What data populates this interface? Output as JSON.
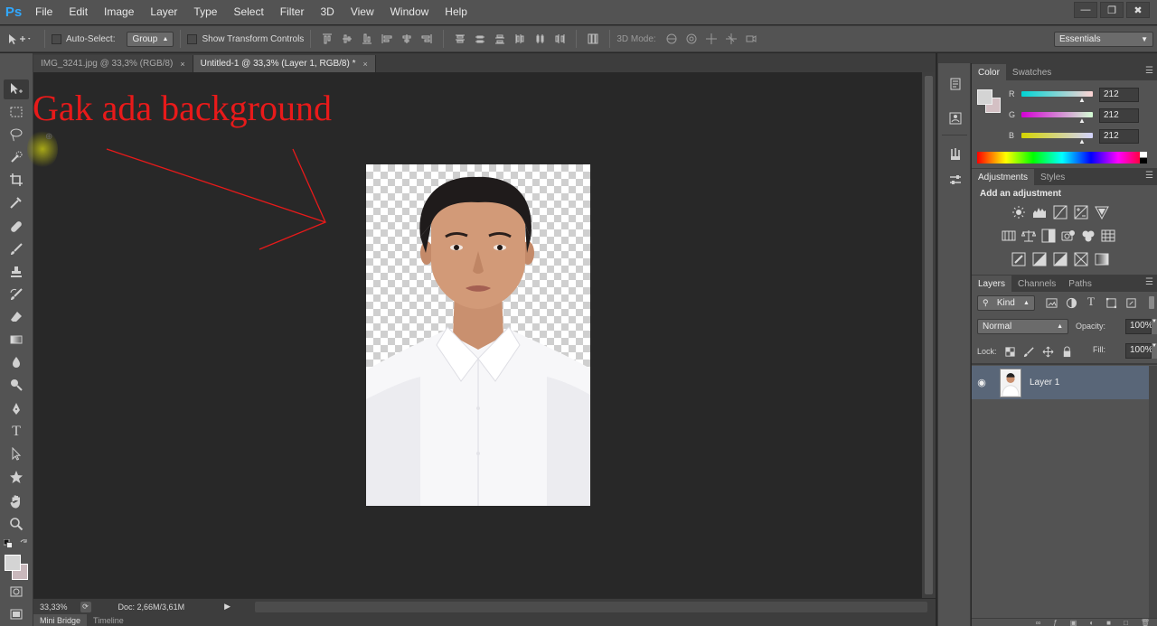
{
  "app": {
    "logo": "Ps"
  },
  "menu": [
    "File",
    "Edit",
    "Image",
    "Layer",
    "Type",
    "Select",
    "Filter",
    "3D",
    "View",
    "Window",
    "Help"
  ],
  "window_controls": {
    "minimize": "—",
    "restore": "❐",
    "close": "✖"
  },
  "options_bar": {
    "auto_select_label": "Auto-Select:",
    "auto_select_value": "Group",
    "show_transform_label": "Show Transform Controls",
    "mode_3d_label": "3D Mode:",
    "workspace": "Essentials"
  },
  "doc_tabs": [
    {
      "label": "IMG_3241.jpg @ 33,3% (RGB/8)",
      "close": "×"
    },
    {
      "label": "Untitled-1 @ 33,3% (Layer 1, RGB/8) *",
      "close": "×"
    }
  ],
  "annotation": {
    "text": "Gak ada background",
    "color": "#e81a1a"
  },
  "status": {
    "zoom": "33,33%",
    "doc": "Doc: 2,66M/3,61M"
  },
  "bottom_tabs": [
    "Mini Bridge",
    "Timeline"
  ],
  "color_panel": {
    "tabs": [
      "Color",
      "Swatches"
    ],
    "channels": [
      {
        "label": "R",
        "value": "212"
      },
      {
        "label": "G",
        "value": "212"
      },
      {
        "label": "B",
        "value": "212"
      }
    ]
  },
  "adjustments_panel": {
    "tabs": [
      "Adjustments",
      "Styles"
    ],
    "heading": "Add an adjustment"
  },
  "layers_panel": {
    "tabs": [
      "Layers",
      "Channels",
      "Paths"
    ],
    "filter_kind": "Kind",
    "blend_mode": "Normal",
    "opacity_label": "Opacity:",
    "opacity_value": "100%",
    "lock_label": "Lock:",
    "fill_label": "Fill:",
    "fill_value": "100%",
    "layers": [
      {
        "name": "Layer 1",
        "selected": true,
        "visible": true
      }
    ]
  },
  "colors": {
    "accent": "#31a8ff",
    "selected_layer": "#596678",
    "annotation_red": "#e81a1a"
  }
}
